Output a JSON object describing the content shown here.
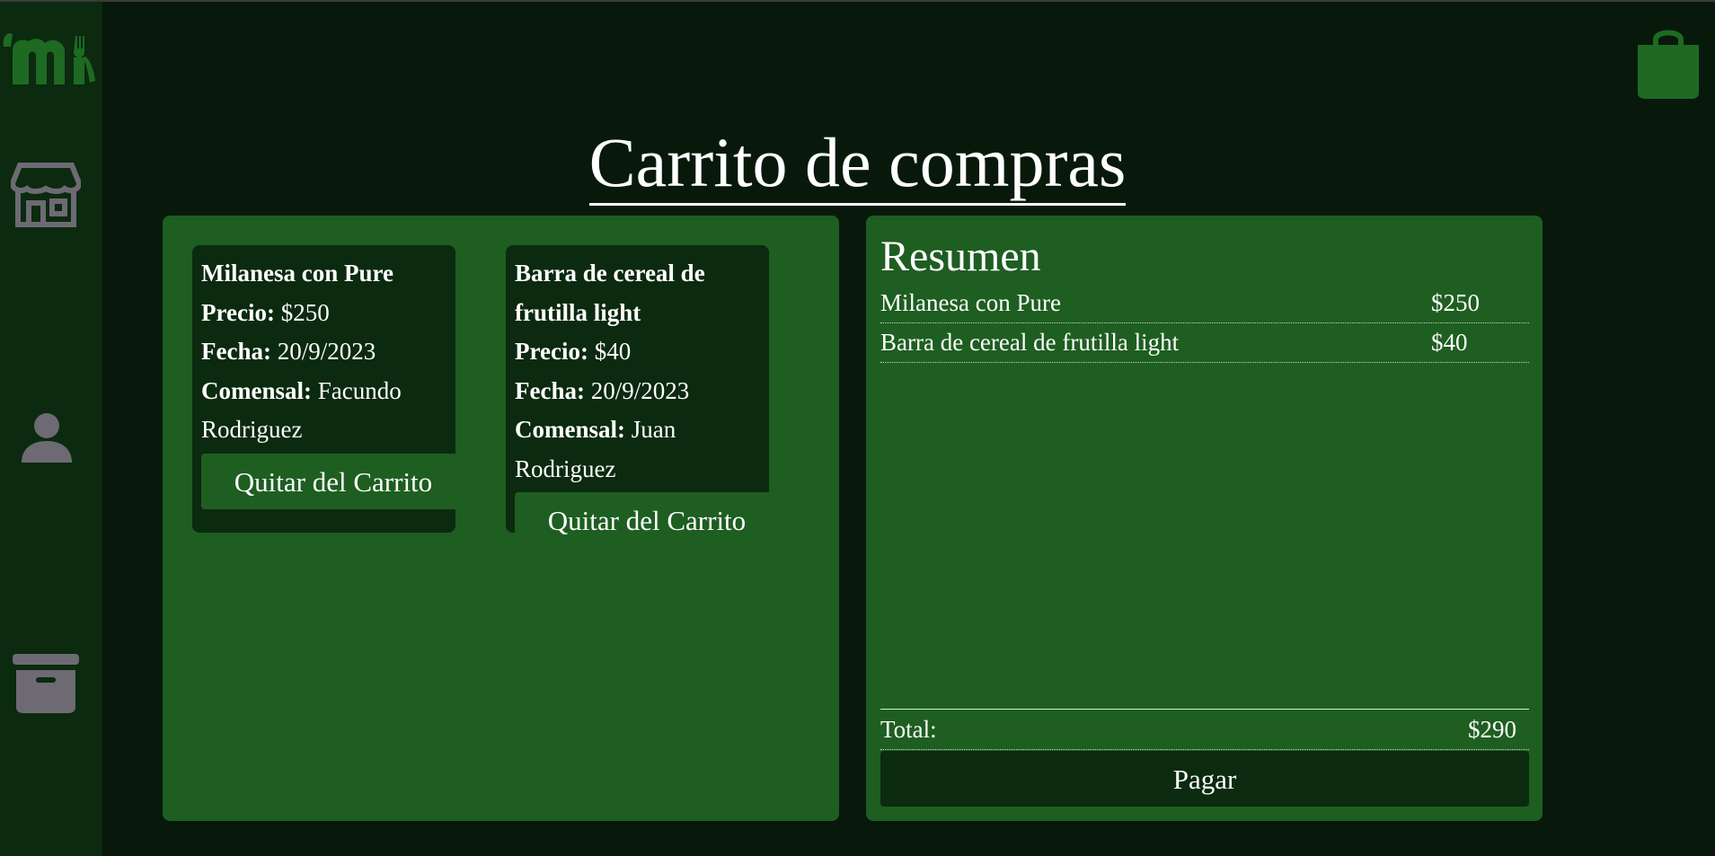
{
  "page": {
    "title": "Carrito de compras"
  },
  "nav": {
    "logo": "logo-icon",
    "items": [
      {
        "icon": "store-icon"
      },
      {
        "icon": "user-icon"
      },
      {
        "icon": "archive-icon"
      }
    ],
    "cart_icon": "shopping-bag-icon"
  },
  "colors": {
    "background": "#08190b",
    "sidebar": "#0b2a0f",
    "panel": "#1e5e21",
    "card": "#0b2a0f",
    "icon_gray": "#6d6a73",
    "accent_green": "#1e6a22"
  },
  "cart": {
    "items": [
      {
        "name": "Milanesa con Pure",
        "price_label": "Precio:",
        "price": "$250",
        "date_label": "Fecha:",
        "date": "20/9/2023",
        "diner_label": "Comensal:",
        "diner_first": "Facundo",
        "diner_last": "Rodriguez",
        "remove_label": "Quitar del Carrito"
      },
      {
        "name_line1": "Barra de cereal de",
        "name_line2": "frutilla light",
        "price_label": "Precio:",
        "price": "$40",
        "date_label": "Fecha:",
        "date": "20/9/2023",
        "diner_label": "Comensal:",
        "diner_first": "Juan",
        "diner_last": "Rodriguez",
        "remove_label": "Quitar del Carrito"
      }
    ]
  },
  "summary": {
    "title": "Resumen",
    "rows": [
      {
        "name": "Milanesa con Pure",
        "price": "$250"
      },
      {
        "name": "Barra de cereal de frutilla light",
        "price": "$40"
      }
    ],
    "total_label": "Total:",
    "total_value": "$290",
    "pay_label": "Pagar"
  }
}
